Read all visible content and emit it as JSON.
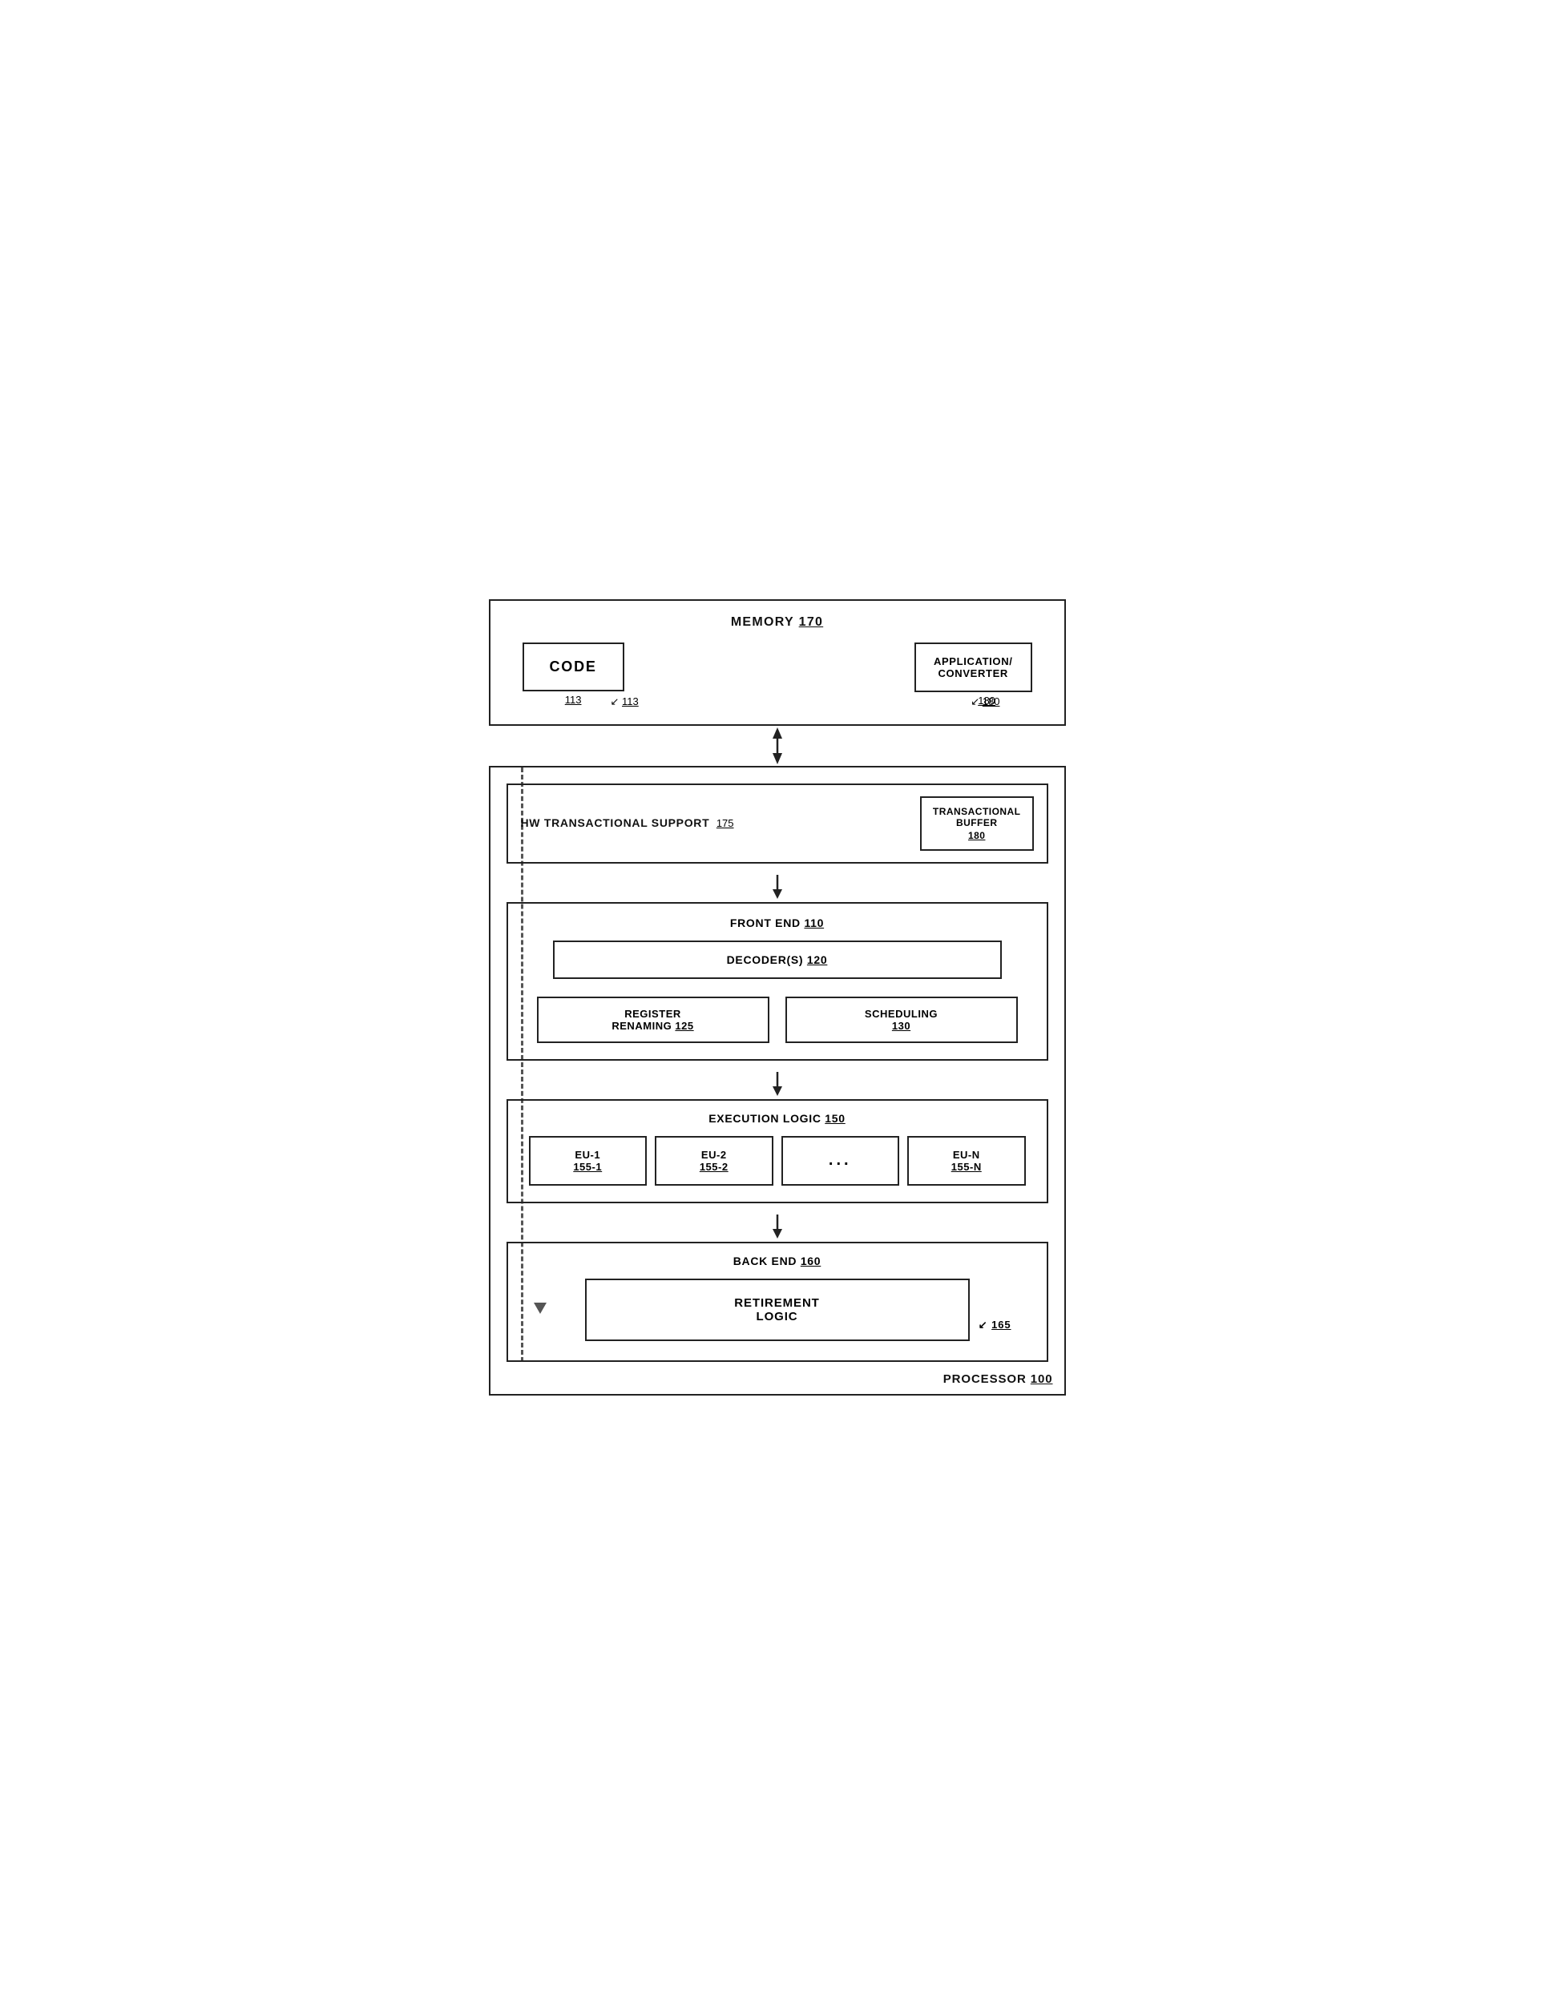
{
  "memory": {
    "title": "MEMORY",
    "ref": "170",
    "code_label": "CODE",
    "code_ref": "113",
    "app_label": "APPLICATION/\nCONVERTER",
    "app_ref": "180"
  },
  "processor": {
    "label": "PROCESSOR",
    "ref": "100"
  },
  "hw": {
    "title": "HW TRANSACTIONAL SUPPORT",
    "ref": "175",
    "buffer_label": "TRANSACTIONAL\nBUFFER",
    "buffer_ref": "180"
  },
  "frontend": {
    "title": "FRONT END",
    "ref": "110",
    "decoder_label": "DECODER(S)",
    "decoder_ref": "120",
    "reg_label": "REGISTER\nRENAMING",
    "reg_ref": "125",
    "sched_label": "SCHEDULING",
    "sched_ref": "130"
  },
  "execution": {
    "title": "EXECUTION LOGIC",
    "ref": "150",
    "eu1_label": "EU-1",
    "eu1_ref": "155-1",
    "eu2_label": "EU-2",
    "eu2_ref": "155-2",
    "eu_dots": "...",
    "eun_label": "EU-N",
    "eun_ref": "155-N"
  },
  "backend": {
    "title": "BACK END",
    "ref": "160",
    "retirement_label": "RETIREMENT\nLOGIC",
    "retirement_ref": "165"
  }
}
